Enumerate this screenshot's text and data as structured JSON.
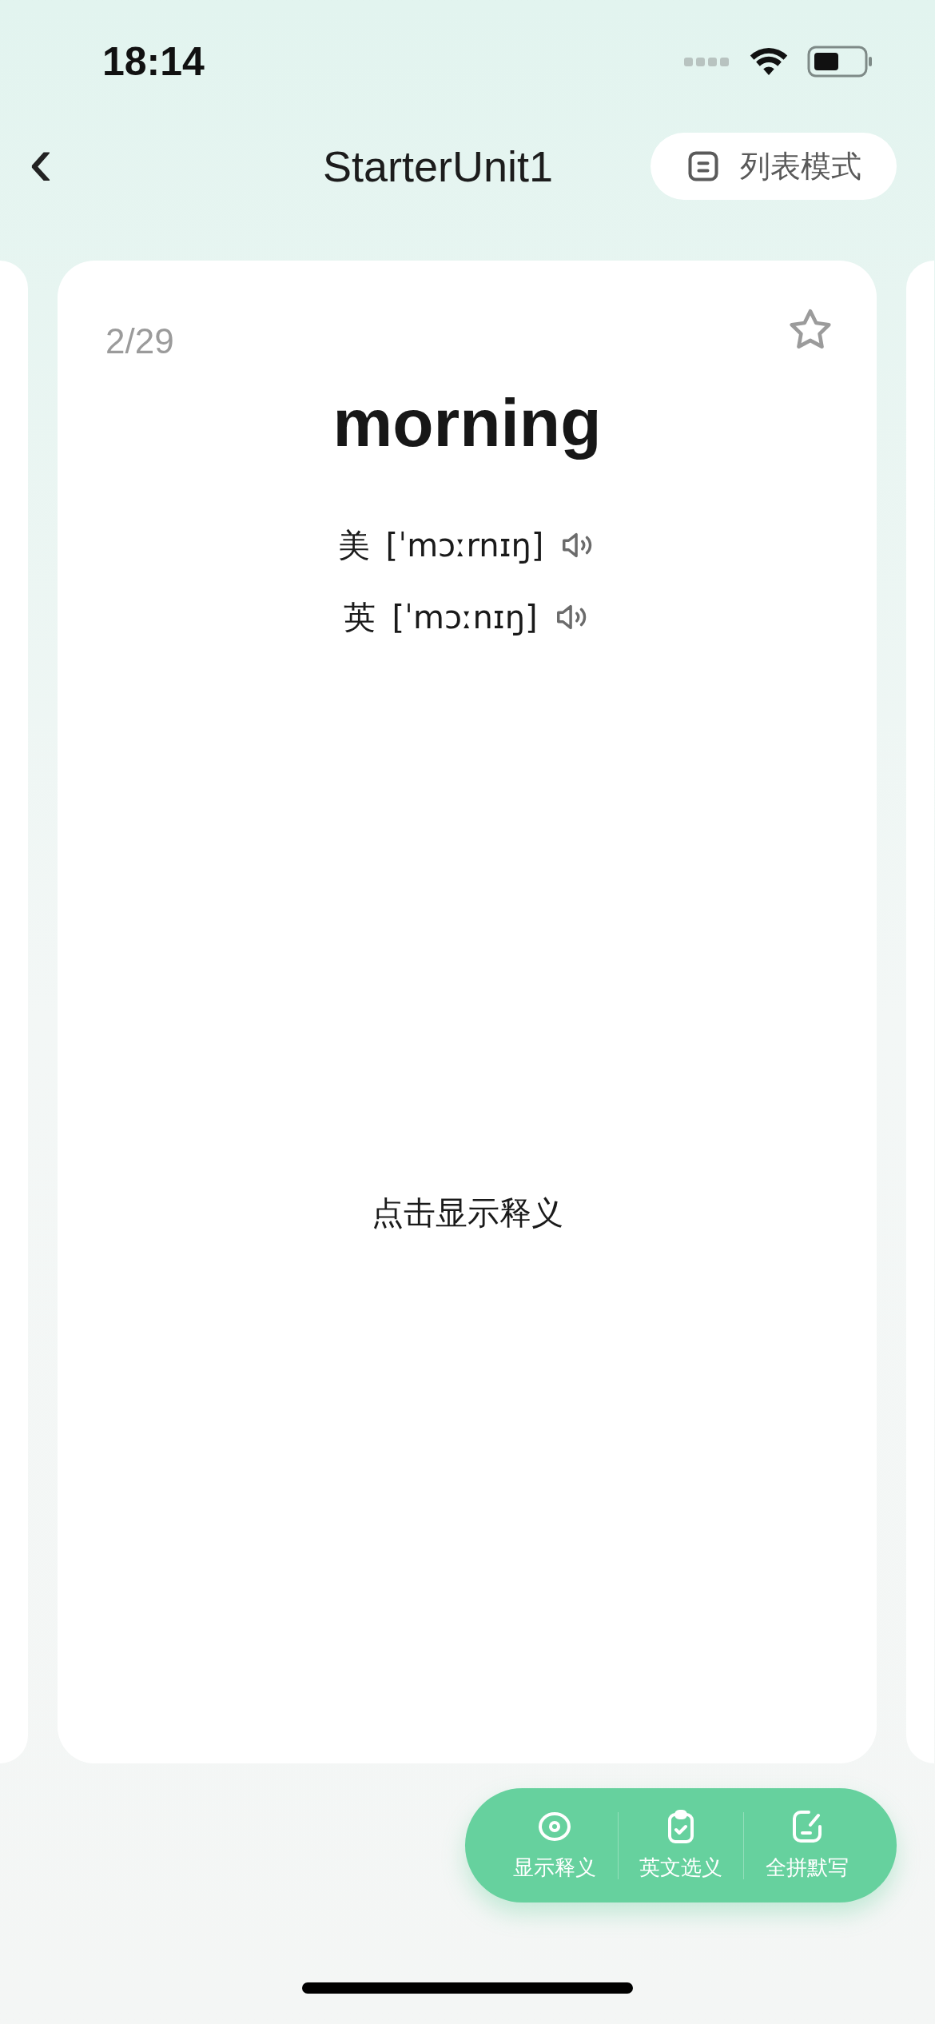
{
  "status_bar": {
    "time": "18:14"
  },
  "nav": {
    "back": "‹",
    "title": "StarterUnit1",
    "mode_button": "列表模式"
  },
  "card": {
    "counter": "2/29",
    "favorited": false,
    "word": "morning",
    "pronunciations": [
      {
        "region": "美",
        "phonetic": "[ˈmɔːrnɪŋ]"
      },
      {
        "region": "英",
        "phonetic": "[ˈmɔːnɪŋ]"
      }
    ],
    "hint": "点击显示释义"
  },
  "actions": [
    {
      "kind": "eye",
      "label": "显示释义"
    },
    {
      "kind": "clipboard",
      "label": "英文选义"
    },
    {
      "kind": "edit",
      "label": "全拼默写"
    }
  ]
}
